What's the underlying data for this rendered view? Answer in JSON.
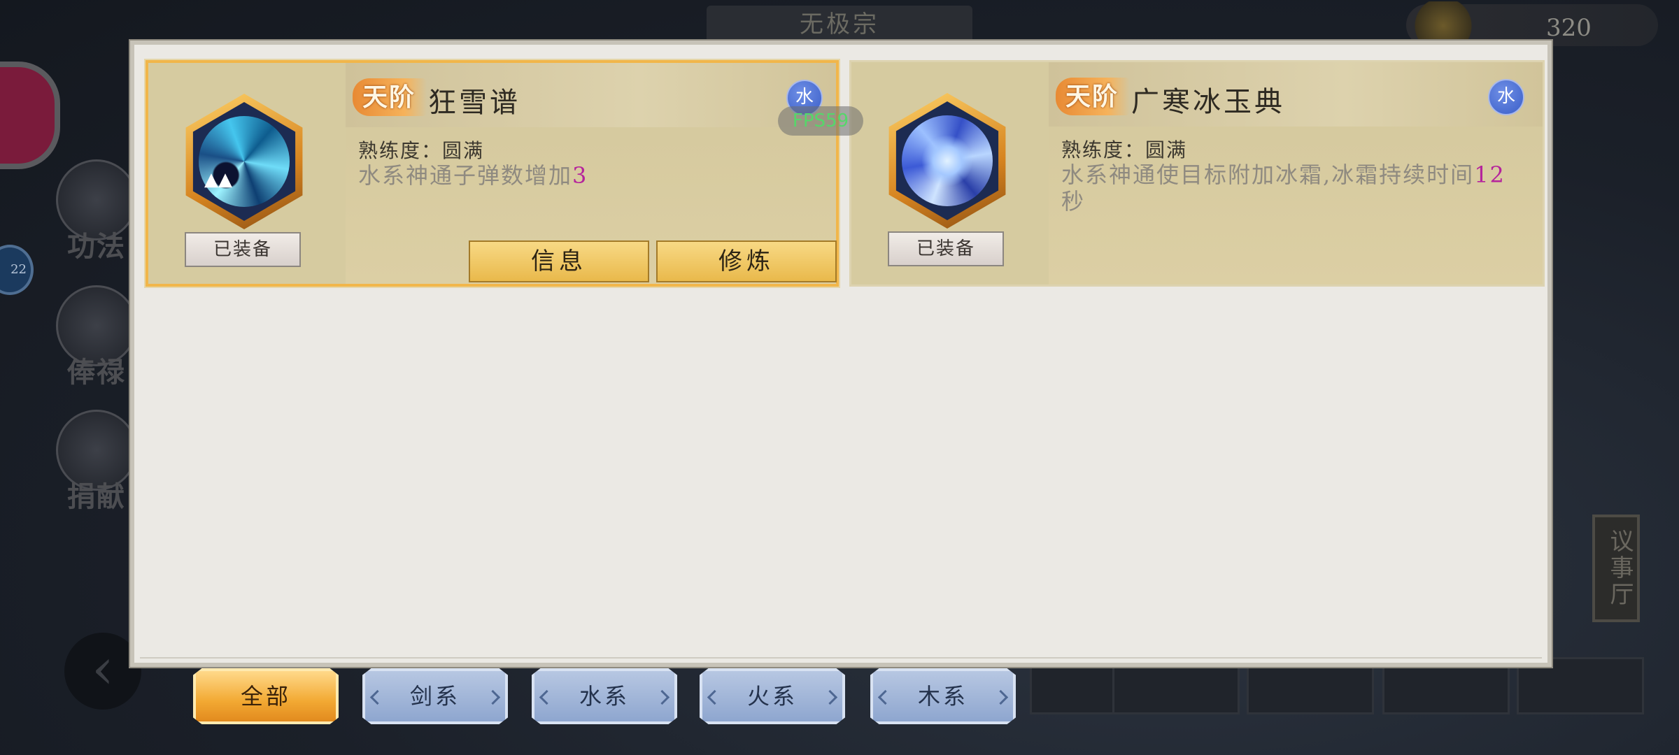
{
  "background": {
    "banner": "无极宗",
    "currency": "320",
    "side_labels": [
      "功法",
      "俸禄",
      "捐献"
    ],
    "badge": "22",
    "hall": "议事厅"
  },
  "fps": "FPS59",
  "cards": [
    {
      "tier": "天阶",
      "name": "狂雪谱",
      "element": "水",
      "mastery": "熟练度：圆满",
      "desc_prefix": "水系神通子弹数增加",
      "desc_value": "3",
      "desc_suffix": "",
      "equipped": "已装备",
      "icon": "ice-vortex-icon",
      "buttons": {
        "info": "信息",
        "train": "修炼"
      }
    },
    {
      "tier": "天阶",
      "name": "广寒冰玉典",
      "element": "水",
      "mastery": "熟练度：圆满",
      "desc_prefix": "水系神通使目标附加冰霜,冰霜持续时间",
      "desc_value": "12",
      "desc_suffix": "秒",
      "equipped": "已装备",
      "icon": "frost-orb-icon"
    }
  ],
  "tabs": [
    {
      "label": "全部",
      "active": true
    },
    {
      "label": "剑系",
      "active": false
    },
    {
      "label": "水系",
      "active": false
    },
    {
      "label": "火系",
      "active": false
    },
    {
      "label": "木系",
      "active": false
    }
  ],
  "colors": {
    "highlight": "#b5239c",
    "active_tab": "#f2a933",
    "idle_tab": "#8ea6cf",
    "element_badge": "#3a5ec8"
  }
}
